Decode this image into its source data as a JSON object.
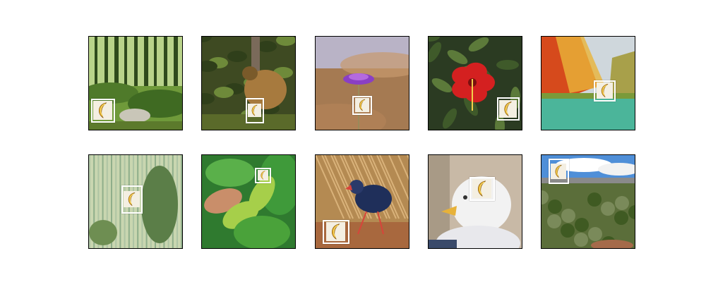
{
  "figure": {
    "object_icon": "banana-crescent-icon",
    "box_color": "#ffffff",
    "tiles": [
      {
        "scene": "forest",
        "colors": [
          "#2f4a1c",
          "#6f9a3a",
          "#9bbf5a"
        ]
      },
      {
        "scene": "forest-animal",
        "colors": [
          "#3e4a22",
          "#7a5a2a",
          "#a77a3e"
        ]
      },
      {
        "scene": "purple-flower",
        "colors": [
          "#b9b3c6",
          "#a57a52",
          "#8a3fc4"
        ]
      },
      {
        "scene": "red-hibiscus",
        "colors": [
          "#2b3b22",
          "#d42020",
          "#5c7a3a"
        ]
      },
      {
        "scene": "autumn-river",
        "colors": [
          "#d64a1c",
          "#e8b43a",
          "#4bb59a"
        ]
      },
      {
        "scene": "wheat-field",
        "colors": [
          "#8fae8a",
          "#5b7e48",
          "#c9d6b0"
        ]
      },
      {
        "scene": "hand-leaves",
        "colors": [
          "#2f7a2f",
          "#a6cf4a",
          "#c98e6a"
        ]
      },
      {
        "scene": "swamphen-bird",
        "colors": [
          "#b48a52",
          "#1f2f5a",
          "#d8443a"
        ]
      },
      {
        "scene": "seagull",
        "colors": [
          "#c8b9a6",
          "#f2f2f2",
          "#e7b23a"
        ]
      },
      {
        "scene": "desert-landscape",
        "colors": [
          "#4f8fd8",
          "#5b6e3a",
          "#a56a4a"
        ]
      }
    ]
  }
}
